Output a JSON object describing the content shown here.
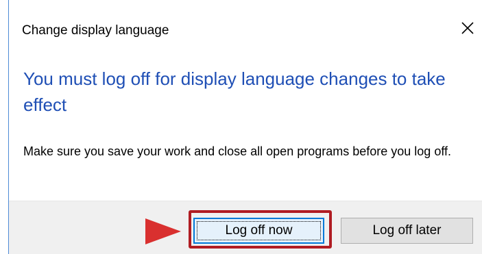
{
  "window": {
    "title": "Change display language",
    "close_icon": "close-icon"
  },
  "content": {
    "heading": "You must log off for display language changes to take effect",
    "message": "Make sure you save your work and close all open programs before you log off."
  },
  "buttons": {
    "log_off_now": "Log off now",
    "log_off_later": "Log off later"
  },
  "annotation": {
    "highlight_color": "#b01c22",
    "arrow_color": "#d9302f",
    "arrow_icon": "pointer-arrow-icon"
  },
  "colors": {
    "heading": "#1f4fb5",
    "accent": "#0078d7",
    "footer": "#f0f0f0"
  }
}
